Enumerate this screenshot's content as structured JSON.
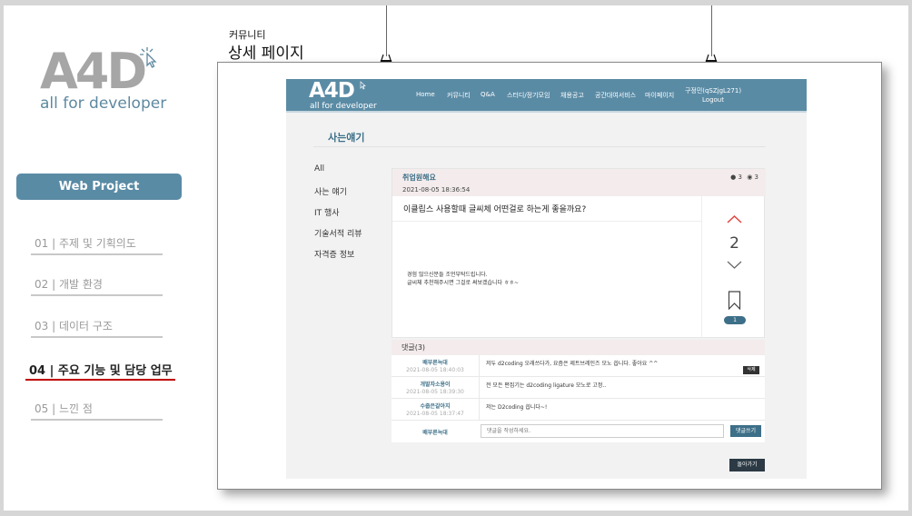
{
  "presentation": {
    "logo": {
      "mark": "A4D",
      "tagline": "all for developer"
    },
    "project_button": "Web Project",
    "menu": [
      {
        "label": "01 |  주제 및 기획의도"
      },
      {
        "label": "02 |  개발 환경"
      },
      {
        "label": "03 |  데이터 구조"
      },
      {
        "label": "04 |  주요 기능 및 담당 업무"
      },
      {
        "label": "05 |  느낀 점"
      }
    ],
    "breadcrumb": "커뮤니티",
    "page_title": "상세 페이지"
  },
  "site": {
    "logo": {
      "mark": "A4D",
      "tagline": "all for developer"
    },
    "nav": [
      "Home",
      "커뮤니티",
      "Q&A",
      "스터디/정기모임",
      "채용공고",
      "공간대여서비스",
      "마이페이지"
    ],
    "user": {
      "name": "구정민(qSZjgL271)",
      "logout": "Logout"
    },
    "board_title": "사는얘기",
    "categories": [
      "All",
      "사는 얘기",
      "IT 행사",
      "기술서적 리뷰",
      "자격증 정보"
    ],
    "post": {
      "category": "취업원해요",
      "date": "2021-08-05 18:36:54",
      "comment_count": "3",
      "view_count": "3",
      "title": "이클립스 사용할때 글씨체 어떤걸로 하는게 좋을까요?",
      "body_line1": "경험 많으신분들 조언부탁드립니다.",
      "body_line2": "글씨체 추천해주시면 그걸로 써보겠습니다 ㅎㅎ~",
      "votes": "2",
      "bookmarks": "1"
    },
    "comments": {
      "title": "댓글(3)",
      "items": [
        {
          "author": "배부른늑대",
          "date": "2021-08-05 18:40:03",
          "text": "저두 d2coding 오래쓰다가, 요즘은 제트브레인즈 모노 씁니다. 좋아요 ^^"
        },
        {
          "author": "개발자소용이",
          "date": "2021-08-05 18:39:30",
          "text": "전 모든 편집기는 d2coding ligature 모노로 고정.."
        },
        {
          "author": "수줍은갈아지",
          "date": "2021-08-05 18:37:47",
          "text": "저는 D2coding 씁니다~!"
        }
      ],
      "delete_label": "삭제",
      "current_user": "배부른늑대",
      "input_placeholder": "댓글을 작성하세요.",
      "submit_label": "댓글쓰기"
    },
    "back_label": "돌아가기"
  },
  "colors": {
    "accent": "#5a8ba5",
    "active_underline": "#c00000",
    "vote_up": "#e0403a"
  }
}
